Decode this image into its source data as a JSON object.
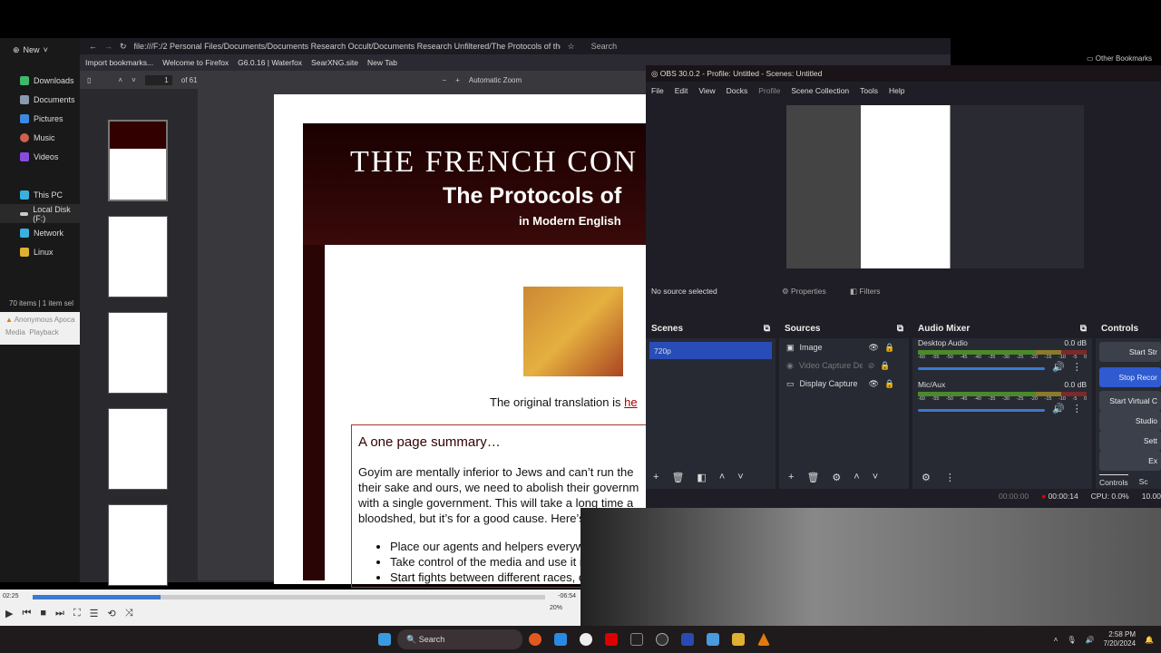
{
  "browser": {
    "url": "file:///F:/2 Personal Files/Documents/Documents Research Occult/Documents Research Unfiltered/The Protocols of the",
    "search_placeholder": "Search",
    "other_bookmarks": "Other Bookmarks",
    "bookmarks": [
      "Import bookmarks...",
      "Welcome to Firefox",
      "G6.0.16 | Waterfox",
      "SearXNG.site",
      "New Tab"
    ],
    "pdf": {
      "page": "1",
      "page_count": "of 61",
      "zoom": "Automatic Zoom",
      "title_line1": "THE FRENCH CON",
      "title_line2": "The Protocols of",
      "title_line3": "in Modern English",
      "translation_text": "The original translation is ",
      "translation_link": "he",
      "summary_heading": "A one page summary…",
      "summary_lines": [
        "Goyim are mentally inferior to Jews and can’t run the",
        "their sake and ours, we need to abolish their governm",
        "with a single government.  This will take a long time a",
        "bloodshed, but it’s for a good cause.  Here’s what we’ll need to do:"
      ],
      "bullets": [
        "Place our agents and helpers everywhere",
        "Take control of the media and use it in propaganda for our plans",
        "Start fights between different races, classes and religions"
      ]
    }
  },
  "explorer": {
    "new_label": "New",
    "items": [
      {
        "label": "Downloads",
        "color": "#3cba6a"
      },
      {
        "label": "Documents",
        "color": "#8a9bb0"
      },
      {
        "label": "Pictures",
        "color": "#3a8ae0"
      },
      {
        "label": "Music",
        "color": "#d0604a"
      },
      {
        "label": "Videos",
        "color": "#8a4ae0"
      }
    ],
    "tree": [
      {
        "label": "This PC",
        "color": "#3ab0e0"
      },
      {
        "label": "Local Disk (F:)",
        "color": "#ccc"
      },
      {
        "label": "Network",
        "color": "#3ab0e0"
      },
      {
        "label": "Linux",
        "color": "#e0b030"
      }
    ],
    "status": "70 items  |  1 item sel"
  },
  "vlc": {
    "title": "Anonymous Apoca",
    "menu": [
      "Media",
      "Playback"
    ],
    "elapsed": "02:25",
    "remaining": "-06:54",
    "volume": "20%",
    "progress": 0.25
  },
  "obs": {
    "title": "OBS 30.0.2 - Profile: Untitled - Scenes: Untitled",
    "menu": [
      "File",
      "Edit",
      "View",
      "Docks",
      "Profile",
      "Scene Collection",
      "Tools",
      "Help"
    ],
    "no_source": "No source selected",
    "properties": "Properties",
    "filters": "Filters",
    "scenes_title": "Scenes",
    "scenes": [
      "720p"
    ],
    "sources_title": "Sources",
    "sources": [
      "Image",
      "Video Capture Devi",
      "Display Capture"
    ],
    "mixer_title": "Audio Mixer",
    "channels": [
      {
        "name": "Desktop Audio",
        "db": "0.0 dB"
      },
      {
        "name": "Mic/Aux",
        "db": "0.0 dB"
      }
    ],
    "meter_ticks": [
      "-60",
      "-55",
      "-50",
      "-45",
      "-40",
      "-35",
      "-30",
      "-25",
      "-20",
      "-15",
      "-10",
      "-5",
      "0"
    ],
    "controls_title": "Controls",
    "controls": [
      "Start Str",
      "Stop Recor",
      "Start Virtual C",
      "Studio",
      "Sett",
      "Ex"
    ],
    "tabs": [
      "Controls",
      "Sc"
    ],
    "status": {
      "stream_time": "00:00:00",
      "rec_time": "00:00:14",
      "cpu": "CPU: 0.0%",
      "fps": "10.00"
    }
  },
  "taskbar": {
    "search": "Search",
    "time": "2:58 PM",
    "date": "7/20/2024"
  }
}
